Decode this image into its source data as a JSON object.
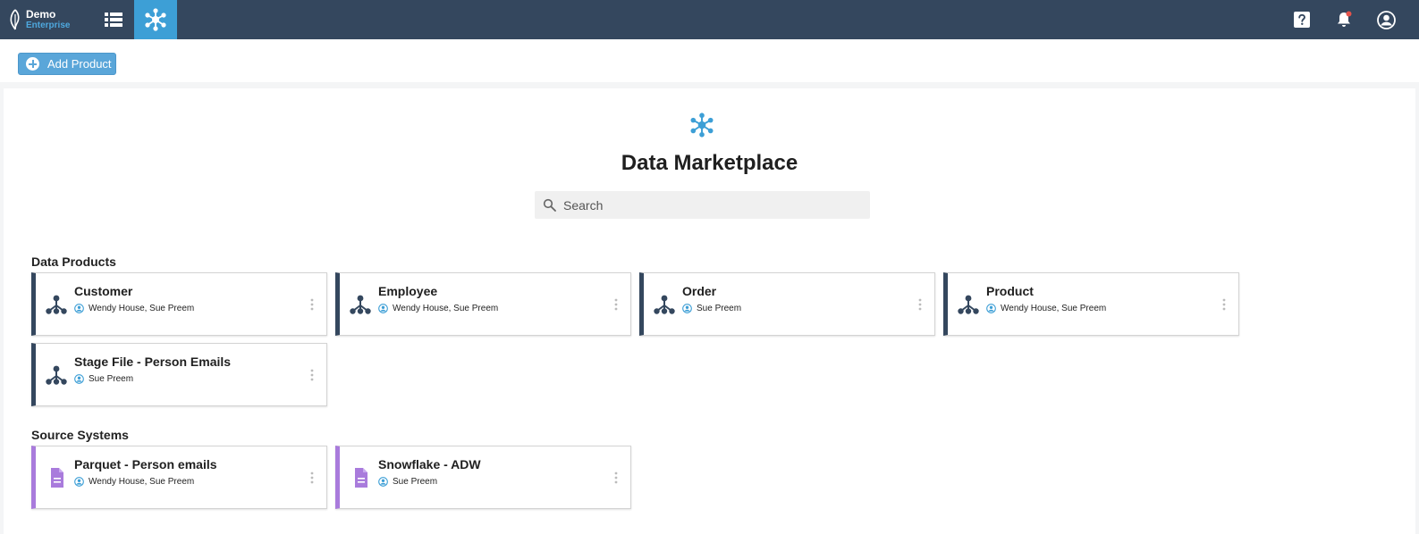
{
  "brand": {
    "name": "Demo",
    "edition": "Enterprise"
  },
  "toolbar": {
    "add_label": "Add Product"
  },
  "main": {
    "title": "Data Marketplace",
    "search": {
      "placeholder": "Search",
      "value": ""
    }
  },
  "sections": {
    "data_products": {
      "title": "Data Products",
      "cards": [
        {
          "title": "Customer",
          "owners": "Wendy House, Sue Preem"
        },
        {
          "title": "Employee",
          "owners": "Wendy House, Sue Preem"
        },
        {
          "title": "Order",
          "owners": "Sue Preem"
        },
        {
          "title": "Product",
          "owners": "Wendy House, Sue Preem"
        },
        {
          "title": "Stage File - Person Emails",
          "owners": "Sue Preem"
        }
      ]
    },
    "source_systems": {
      "title": "Source Systems",
      "cards": [
        {
          "title": "Parquet - Person emails",
          "owners": "Wendy House, Sue Preem"
        },
        {
          "title": "Snowflake - ADW",
          "owners": "Sue Preem"
        }
      ]
    }
  },
  "icons": {
    "nav_list": "list-icon",
    "nav_marketplace": "network-hub-icon",
    "help": "help-icon",
    "notifications": "bell-icon",
    "account": "account-circle-icon",
    "data_product": "hierarchy-icon",
    "source_system": "document-icon",
    "owner": "person-circle-icon"
  },
  "colors": {
    "topbar": "#34475e",
    "accent": "#3d9fd6",
    "data_product_stripe": "#34475e",
    "source_system_stripe": "#a97bdc",
    "notification_dot": "#e5534b"
  }
}
